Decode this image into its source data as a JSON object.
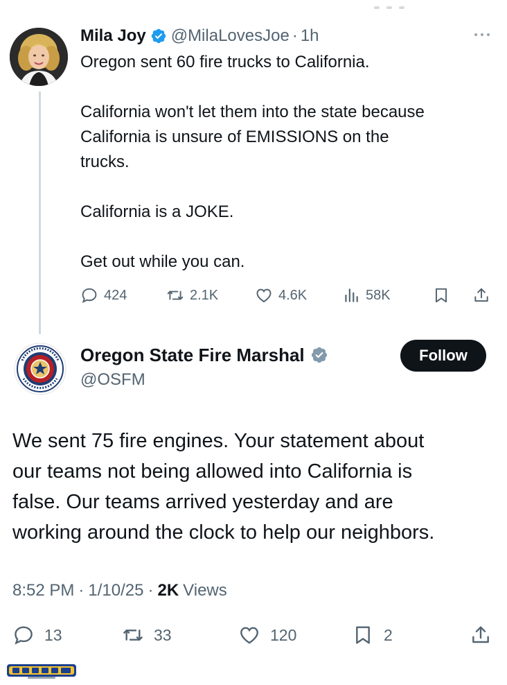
{
  "parent_tweet": {
    "author_name": "Mila Joy",
    "author_handle": "@MilaLovesJoe",
    "separator": "·",
    "time": "1h",
    "text_lines": [
      "Oregon sent 60 fire trucks to California.",
      "",
      "California won't let them into the state because",
      "California is unsure of EMISSIONS on the",
      "trucks.",
      "",
      "California is a JOKE.",
      "",
      "Get out while you can."
    ],
    "stats": {
      "replies": "424",
      "reposts": "2.1K",
      "likes": "4.6K",
      "views": "58K"
    }
  },
  "main_tweet": {
    "author_name": "Oregon State Fire Marshal",
    "author_handle": "@OSFM",
    "follow_label": "Follow",
    "text_lines": [
      "We sent 75 fire engines. Your statement about",
      "our teams not being allowed into California is",
      "false. Our teams arrived yesterday and are",
      "working around the clock to help our neighbors."
    ],
    "meta": {
      "time": "8:52 PM",
      "separator": "·",
      "date": "1/10/25",
      "views_count": "2K",
      "views_label": "Views"
    },
    "stats": {
      "replies": "13",
      "reposts": "33",
      "likes": "120",
      "bookmarks": "2"
    }
  },
  "icons": {
    "verified_blue": "verified-badge-icon",
    "verified_gray": "verified-gray-badge-icon",
    "reply": "reply-icon",
    "repost": "repost-icon",
    "like": "heart-icon",
    "views": "views-chart-icon",
    "bookmark": "bookmark-icon",
    "share": "share-icon",
    "more": "more-dots-icon"
  },
  "colors": {
    "text": "#0f1419",
    "secondary": "#536471",
    "verified": "#1d9bf0",
    "follow_bg": "#0f1419",
    "thread_line": "#cfd9de"
  }
}
